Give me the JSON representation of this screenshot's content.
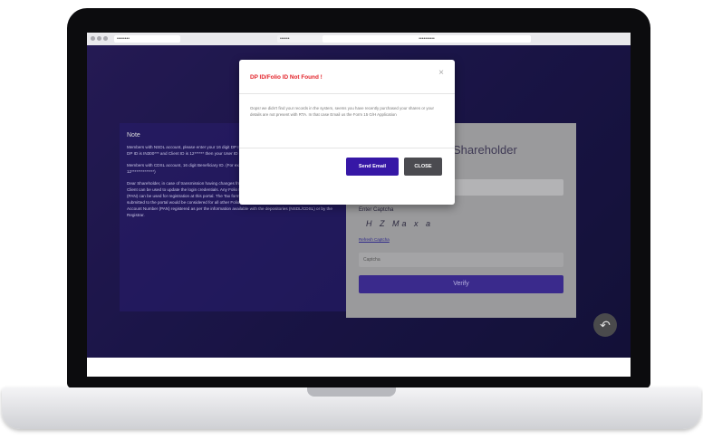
{
  "browser": {
    "tab_title": "••••••••",
    "tab2_title": "••••••",
    "url": "••••••••••"
  },
  "note": {
    "title": "Note",
    "paragraphs": [
      "Members with NSDL account, please enter your 16 digit DP ID followed by 8 digit Client ID. (For example, if your DP ID is IN300*** and Client ID is 12****** then your User ID is IN300***12******)",
      "Members with CDSL account, 16 digit Beneficiary ID. (For example, if your Beneficiary ID is 12**************, then 12**************)",
      "Dear Shareholder, in case of transmission having changes from the DPID & Client, then any Folio No/DPID & Client can be used to update the login credentials. Any Folio No/DPID & Client and Permanent Account Number (PAN) can be used for registration at this portal. The Tax forms to be shown through the portal. Documents submitted to the portal would be considered for all other Folio No/DPID & Client which has same Permanent Account Number (PAN) registered as per the information available with the depositories (NSDL/CDSL) or by the Registrar."
    ]
  },
  "form": {
    "title": "Shareholder",
    "captcha_label": "Enter Captcha",
    "captcha_text": "H Z Ma x a",
    "refresh_link": "Refresh Captcha",
    "captcha_placeholder": "Captcha",
    "verify_label": "Verify"
  },
  "modal": {
    "title": "DP ID/Folio ID Not Found !",
    "close_symbol": "×",
    "body": "Oops! we didn't find your records in the system, seems you have recently purchased your shares or your details are not present with RTA. In that case Email us the Form 15 G/H Application",
    "send_email_label": "Send Email",
    "close_label": "CLOSE"
  },
  "fab": {
    "icon": "↶"
  },
  "colors": {
    "primary": "#3617a6",
    "error": "#e3242b",
    "background": "#2b2273"
  }
}
